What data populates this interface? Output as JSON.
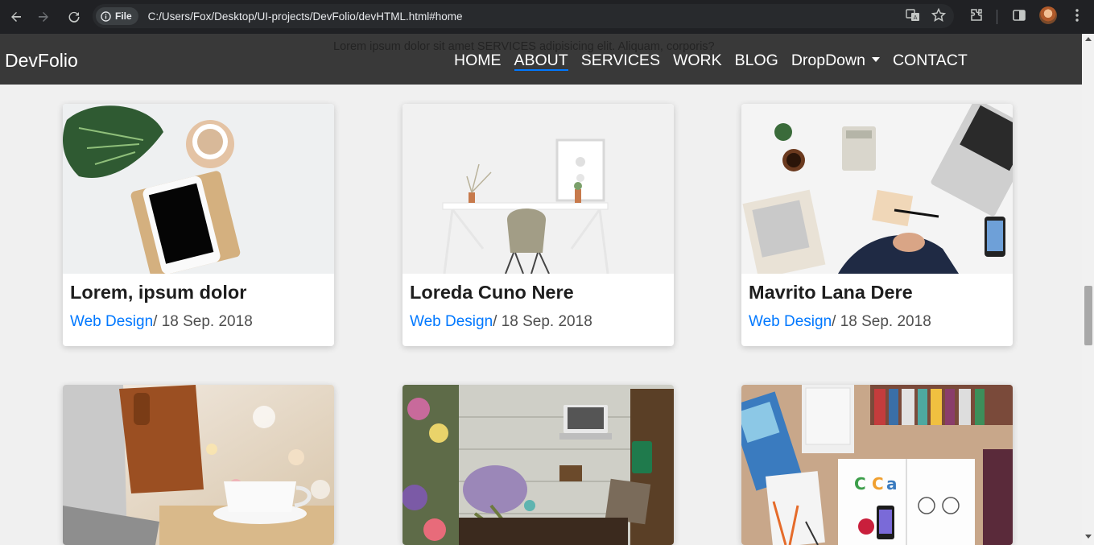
{
  "browser": {
    "site_chip": "File",
    "url": "C:/Users/Fox/Desktop/UI-projects/DevFolio/devHTML.html#home"
  },
  "nav": {
    "brand": "DevFolio",
    "overlay_text": "Lorem ipsum dolor sit amet SERVICES adipisicing elit. Aliquam, corporis?",
    "links": [
      "HOME",
      "ABOUT",
      "SERVICES",
      "WORK",
      "BLOG",
      "DropDown",
      "CONTACT"
    ],
    "accent": "#0078ff"
  },
  "cards": [
    {
      "title": "Lorem, ipsum dolor",
      "category": "Web Design",
      "date": "/ 18 Sep. 2018"
    },
    {
      "title": "Loreda Cuno Nere",
      "category": "Web Design",
      "date": "/ 18 Sep. 2018"
    },
    {
      "title": "Mavrito Lana Dere",
      "category": "Web Design",
      "date": "/ 18 Sep. 2018"
    }
  ]
}
